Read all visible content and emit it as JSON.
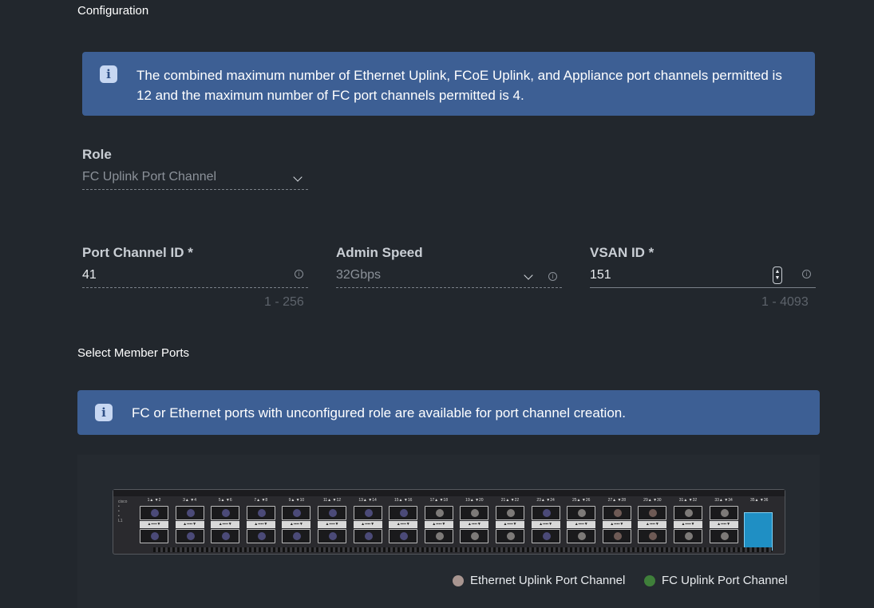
{
  "section_configuration": "Configuration",
  "banner_top": "The combined maximum number of Ethernet Uplink, FCoE Uplink, and Appliance port channels permitted is 12 and the maximum number of FC port channels permitted is 4.",
  "role": {
    "label": "Role",
    "value": "FC Uplink Port Channel"
  },
  "port_channel_id": {
    "label": "Port Channel ID *",
    "value": "41",
    "range": "1 - 256"
  },
  "admin_speed": {
    "label": "Admin Speed",
    "value": "32Gbps"
  },
  "vsan_id": {
    "label": "VSAN ID *",
    "value": "151",
    "range": "1 - 4093"
  },
  "section_member_ports": "Select Member Ports",
  "banner_member": "FC or Ethernet ports with unconfigured role are available for port channel creation.",
  "switch": {
    "port_pairs": [
      {
        "top": "1",
        "bottom": "2"
      },
      {
        "top": "3",
        "bottom": "4"
      },
      {
        "top": "5",
        "bottom": "6"
      },
      {
        "top": "7",
        "bottom": "8"
      },
      {
        "top": "9",
        "bottom": "10"
      },
      {
        "top": "11",
        "bottom": "12"
      },
      {
        "top": "13",
        "bottom": "14"
      },
      {
        "top": "15",
        "bottom": "16"
      },
      {
        "top": "17",
        "bottom": "18"
      },
      {
        "top": "19",
        "bottom": "20"
      },
      {
        "top": "21",
        "bottom": "22"
      },
      {
        "top": "23",
        "bottom": "24"
      },
      {
        "top": "25",
        "bottom": "26"
      },
      {
        "top": "27",
        "bottom": "28"
      },
      {
        "top": "29",
        "bottom": "30"
      },
      {
        "top": "31",
        "bottom": "32"
      },
      {
        "top": "33",
        "bottom": "34"
      },
      {
        "top": "35",
        "bottom": "36"
      }
    ]
  },
  "legend": {
    "ethernet": {
      "label": "Ethernet Uplink Port Channel",
      "color": "#a89590"
    },
    "fc": {
      "label": "FC Uplink Port Channel",
      "color": "#3f7f3a"
    }
  },
  "colors": {
    "background": "#22272d",
    "banner": "#3d5f94"
  }
}
